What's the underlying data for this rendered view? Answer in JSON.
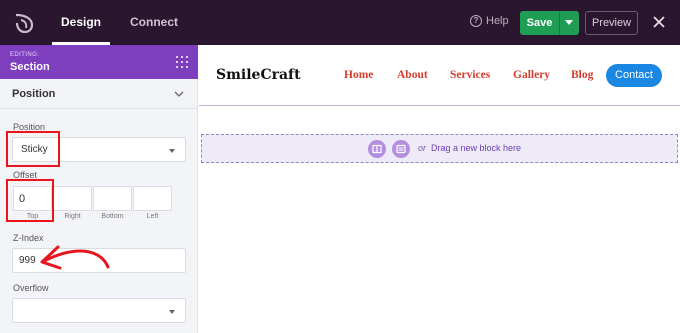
{
  "topbar": {
    "tabs": [
      {
        "label": "Design"
      },
      {
        "label": "Connect"
      }
    ],
    "help_label": "Help",
    "save_label": "Save",
    "preview_label": "Preview"
  },
  "panel": {
    "editing_small": "EDITING:",
    "editing_title": "Section",
    "section_header": "Position",
    "position_label": "Position",
    "position_value": "Sticky",
    "offset_label": "Offset",
    "offsets": [
      {
        "value": "0",
        "label": "Top"
      },
      {
        "value": "",
        "label": "Right"
      },
      {
        "value": "",
        "label": "Bottom"
      },
      {
        "value": "",
        "label": "Left"
      }
    ],
    "zindex_label": "Z-Index",
    "zindex_value": "999",
    "overflow_label": "Overflow",
    "overflow_value": ""
  },
  "canvas": {
    "brand": "SmileCraft",
    "nav": [
      "Home",
      "About",
      "Services",
      "Gallery",
      "Blog"
    ],
    "contact_label": "Contact",
    "dropzone_or": "or",
    "dropzone_text": "Drag a new block here"
  },
  "colors": {
    "topbar_bg": "#2b1630",
    "accent_purple": "#7e3fbf",
    "save_green": "#1f9d55",
    "nav_red": "#d33d2e",
    "contact_blue": "#1a87e3",
    "highlight_red": "#e8151c"
  },
  "icons": [
    "seedprod-logo-icon",
    "help-icon",
    "caret-down-icon",
    "close-icon",
    "grip-icon",
    "chevron-down-icon",
    "columns-icon",
    "block-icon",
    "collapse-handle-icon"
  ]
}
